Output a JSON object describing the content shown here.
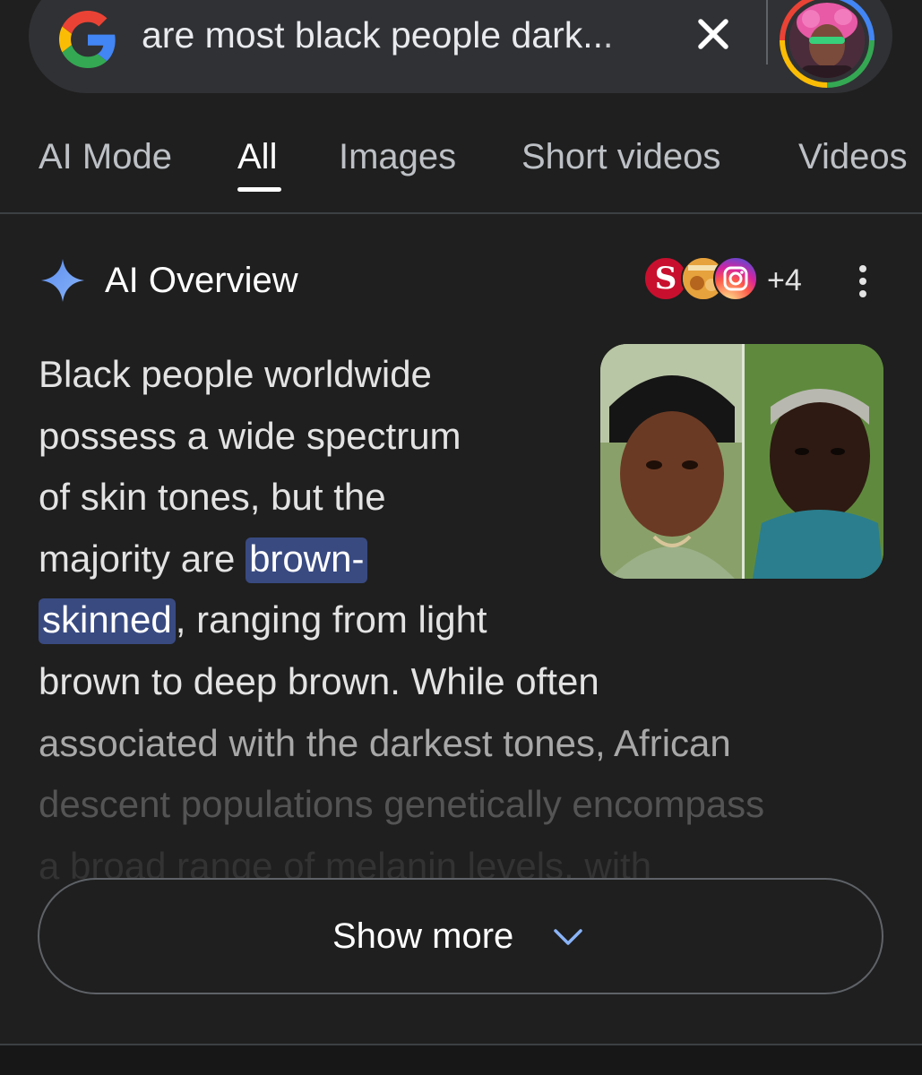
{
  "search": {
    "query": "are most black people dark..."
  },
  "tabs": [
    {
      "label": "AI Mode",
      "active": false
    },
    {
      "label": "All",
      "active": true
    },
    {
      "label": "Images",
      "active": false
    },
    {
      "label": "Short videos",
      "active": false
    },
    {
      "label": "Videos",
      "active": false
    }
  ],
  "ai_overview": {
    "title": "AI Overview",
    "sources_more": "+4",
    "lines": [
      "Black people worldwide",
      "possess a wide spectrum",
      "of skin tones, but the",
      "associated with the darkest tones, African",
      "descent populations genetically encompass",
      "a broad range of melanin levels, with"
    ],
    "line4_before": "majority are ",
    "highlight_part1": "brown-",
    "highlight_part2": "skinned",
    "line5_after": ", ranging from light",
    "line6": "brown to deep brown. While often"
  },
  "show_more": {
    "label": "Show more"
  },
  "icons": {
    "google_logo": "google-g-logo",
    "clear": "close-icon",
    "ai": "sparkle-icon",
    "menu": "more-vert-icon",
    "expand": "chevron-down-icon"
  },
  "colors": {
    "background": "#1f1f1f",
    "highlight": "#394a81",
    "ai_accent": "#4285f4"
  }
}
